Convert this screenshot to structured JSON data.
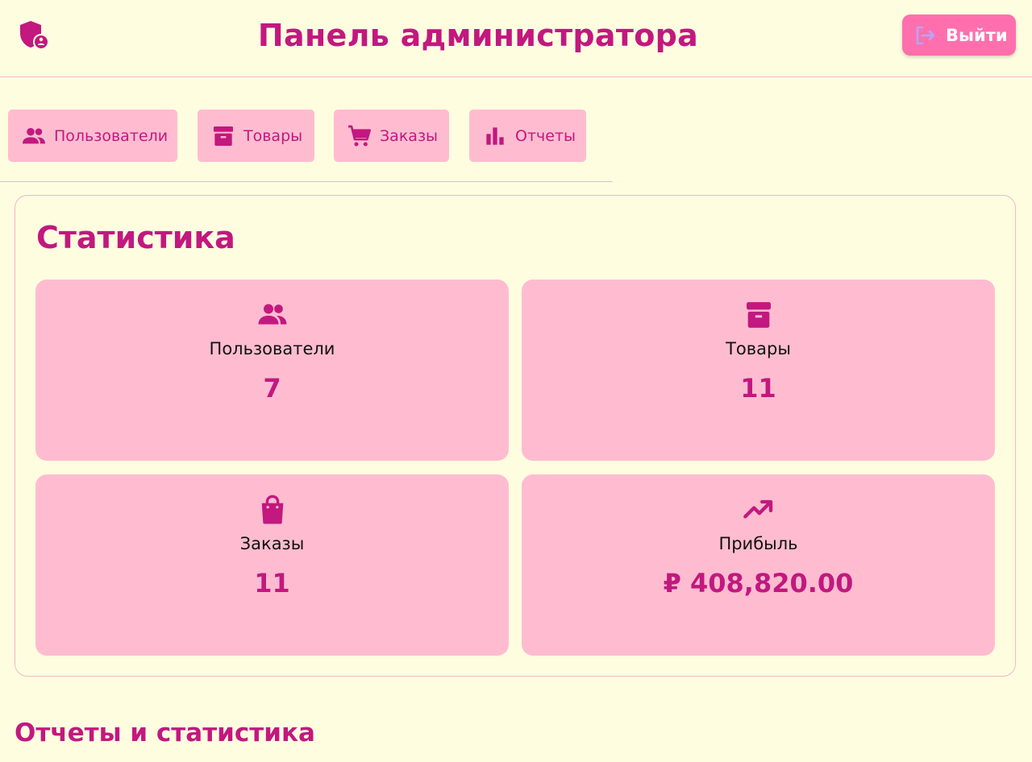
{
  "header": {
    "title": "Панель администратора",
    "logo_icon": "admin-shield-icon",
    "logout_label": "Выйти",
    "logout_icon": "logout-icon"
  },
  "nav": {
    "items": [
      {
        "label": "Пользователи",
        "icon": "users-icon"
      },
      {
        "label": "Товары",
        "icon": "archive-box-icon"
      },
      {
        "label": "Заказы",
        "icon": "cart-icon"
      },
      {
        "label": "Отчеты",
        "icon": "bar-chart-icon"
      }
    ]
  },
  "stats": {
    "title": "Статистика",
    "cards": [
      {
        "label": "Пользователи",
        "value": "7",
        "icon": "users-icon"
      },
      {
        "label": "Товары",
        "value": "11",
        "icon": "archive-box-icon"
      },
      {
        "label": "Заказы",
        "value": "11",
        "icon": "shopping-bag-icon"
      },
      {
        "label": "Прибыль",
        "value": "₽ 408,820.00",
        "icon": "trending-up-icon"
      }
    ]
  },
  "reports": {
    "title": "Отчеты и статистика"
  },
  "colors": {
    "background": "#fffde0",
    "accent": "#c2187f",
    "card": "#ffbcd0",
    "logout_button": "#ff6fae",
    "border": "#f3b6c9"
  }
}
